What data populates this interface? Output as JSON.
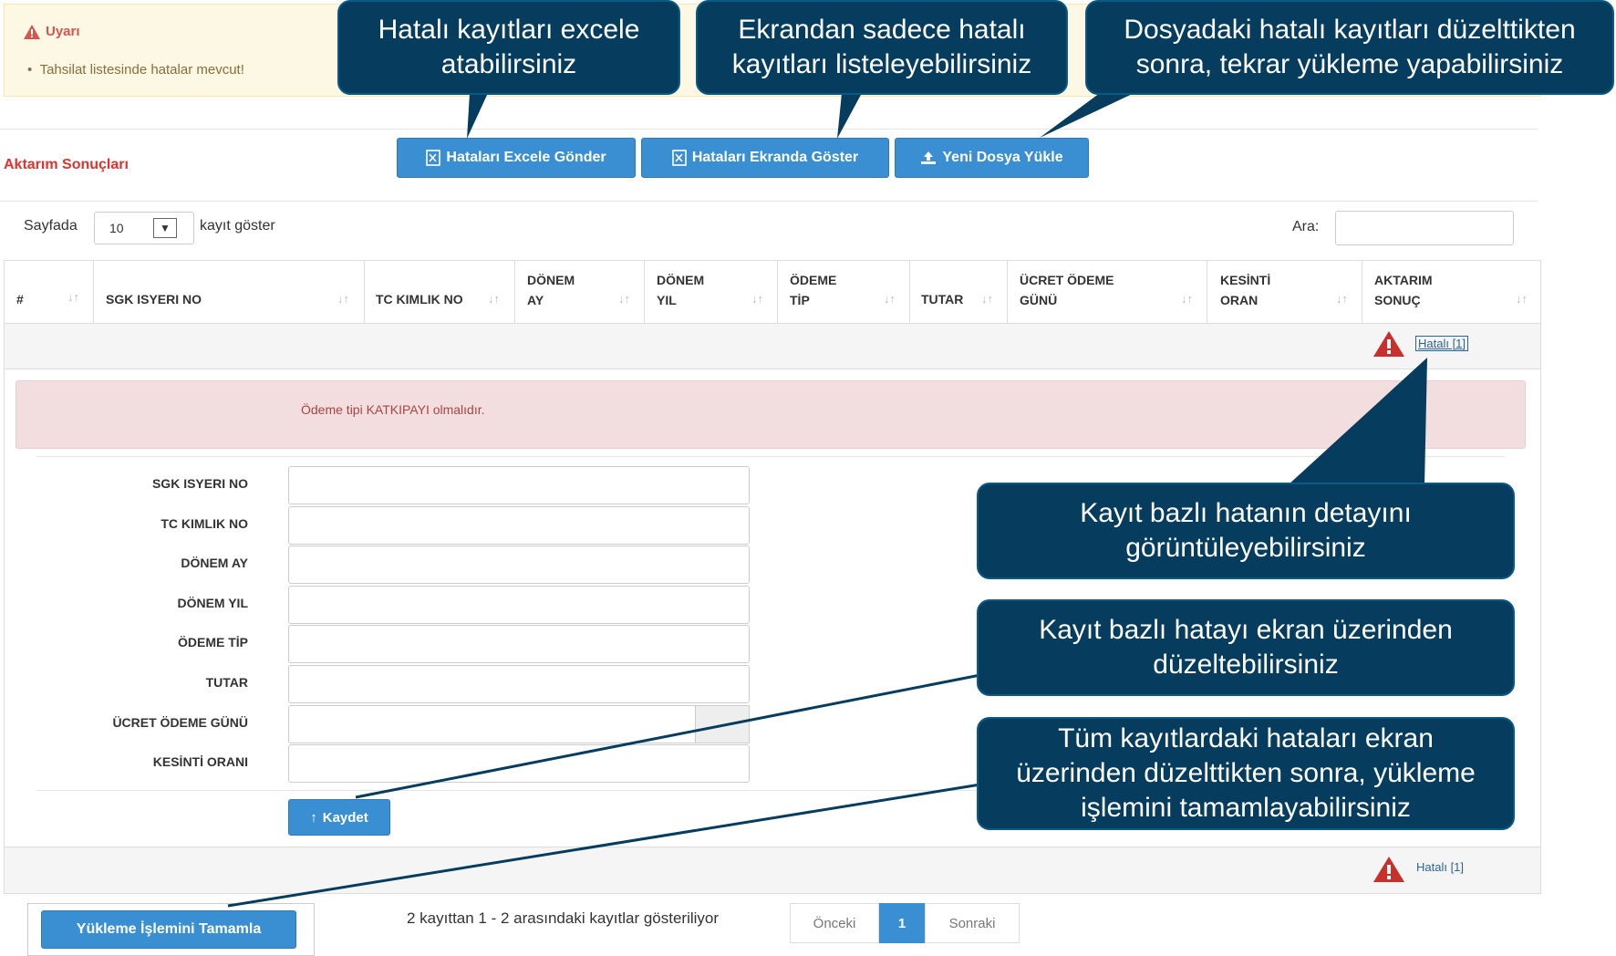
{
  "warning": {
    "title": "Uyarı",
    "message": "Tahsilat listesinde hatalar mevcut!"
  },
  "section_title": "Aktarım Sonuçları",
  "toolbar": {
    "excel_label": "Hataları Excele Gönder",
    "screen_label": "Hataları Ekranda Göster",
    "upload_label": "Yeni Dosya Yükle"
  },
  "length_menu": {
    "prefix": "Sayfada",
    "value": "10",
    "suffix": "kayıt göster"
  },
  "search": {
    "label": "Ara:",
    "value": ""
  },
  "table": {
    "columns": [
      {
        "line1": "#",
        "line2": ""
      },
      {
        "line1": "SGK ISYERI NO",
        "line2": ""
      },
      {
        "line1": "TC KIMLIK NO",
        "line2": ""
      },
      {
        "line1": "DÖNEM",
        "line2": "AY"
      },
      {
        "line1": "DÖNEM",
        "line2": "YIL"
      },
      {
        "line1": "ÖDEME",
        "line2": "TİP"
      },
      {
        "line1": "TUTAR",
        "line2": ""
      },
      {
        "line1": "ÜCRET ÖDEME",
        "line2": "GÜNÜ"
      },
      {
        "line1": "KESİNTİ",
        "line2": "ORAN"
      },
      {
        "line1": "AKTARIM",
        "line2": "SONUÇ"
      }
    ],
    "row1_status": "Hatalı [1]",
    "row2_status": "Hatalı [1]"
  },
  "error_detail": {
    "message": "Ödeme tipi KATKIPAYI olmalıdır."
  },
  "edit_form": {
    "fields": [
      {
        "label": "SGK ISYERI NO",
        "value": ""
      },
      {
        "label": "TC KIMLIK NO",
        "value": ""
      },
      {
        "label": "DÖNEM AY",
        "value": ""
      },
      {
        "label": "DÖNEM YIL",
        "value": ""
      },
      {
        "label": "ÖDEME TİP",
        "value": ""
      },
      {
        "label": "TUTAR",
        "value": ""
      },
      {
        "label": "ÜCRET ÖDEME GÜNÜ",
        "value": ""
      },
      {
        "label": "KESİNTİ ORANI",
        "value": ""
      }
    ],
    "save_label": "Kaydet"
  },
  "callouts": {
    "excel": "Hatalı kayıtları excele\natabilirsiniz",
    "screen": "Ekrandan sadece hatalı\nkayıtları listeleyebilirsiniz",
    "reupload": "Dosyadaki hatalı kayıtları düzelttikten\nsonra, tekrar yükleme yapabilirsiniz",
    "detail": "Kayıt bazlı hatanın detayını\ngörüntüleyebilirsiniz",
    "fix": "Kayıt bazlı hatayı ekran üzerinden\ndüzeltebilirsiniz",
    "complete": "Tüm kayıtlardaki hataları ekran\nüzerinden düzelttikten sonra, yükleme\nişlemini tamamlayabilirsiniz"
  },
  "footer": {
    "info": "2 kayıttan 1 - 2 arasındaki kayıtlar gösteriliyor",
    "prev": "Önceki",
    "page": "1",
    "next": "Sonraki",
    "complete_label": "Yükleme İşlemini Tamamla"
  },
  "colors": {
    "primary_button": "#3a8fd3",
    "callout_bg": "#063d5e",
    "danger_text": "#e0322f",
    "warning_bg": "#fcf8e3",
    "alert_bg": "#f2dede"
  },
  "icons": {
    "warning": "warning-triangle-icon",
    "excel": "file-excel-icon",
    "upload": "upload-icon",
    "save": "arrow-up-icon",
    "sort": "sort-icon"
  }
}
